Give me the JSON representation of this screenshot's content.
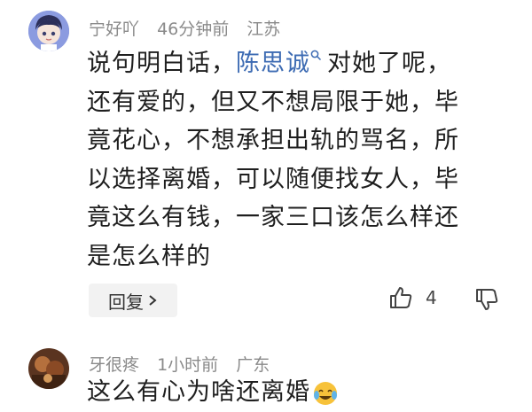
{
  "comments": [
    {
      "username": "宁好吖",
      "time": "46分钟前",
      "location": "江苏",
      "avatar": "cartoon-boy-avatar",
      "text_pre": "说句明白话，",
      "mention": "陈思诚",
      "text_post_line1": "对她了呢，",
      "lines": [
        "还有爱的，但又不想局限于她，毕",
        "竟花心，不想承担出轨的骂名，所",
        "以选择离婚，可以随便找女人，毕",
        "竟这么有钱，一家三口该怎么样还",
        "是怎么样的"
      ],
      "reply_label": "回复",
      "like_count": "4"
    },
    {
      "username": "牙很疼",
      "time": "1小时前",
      "location": "广东",
      "avatar": "photo-avatar",
      "text": "这么有心为啥还离婚"
    }
  ],
  "colors": {
    "meta": "#8a8a8a",
    "mention": "#3d6bb3",
    "reply_bg": "#f2f2f2"
  }
}
